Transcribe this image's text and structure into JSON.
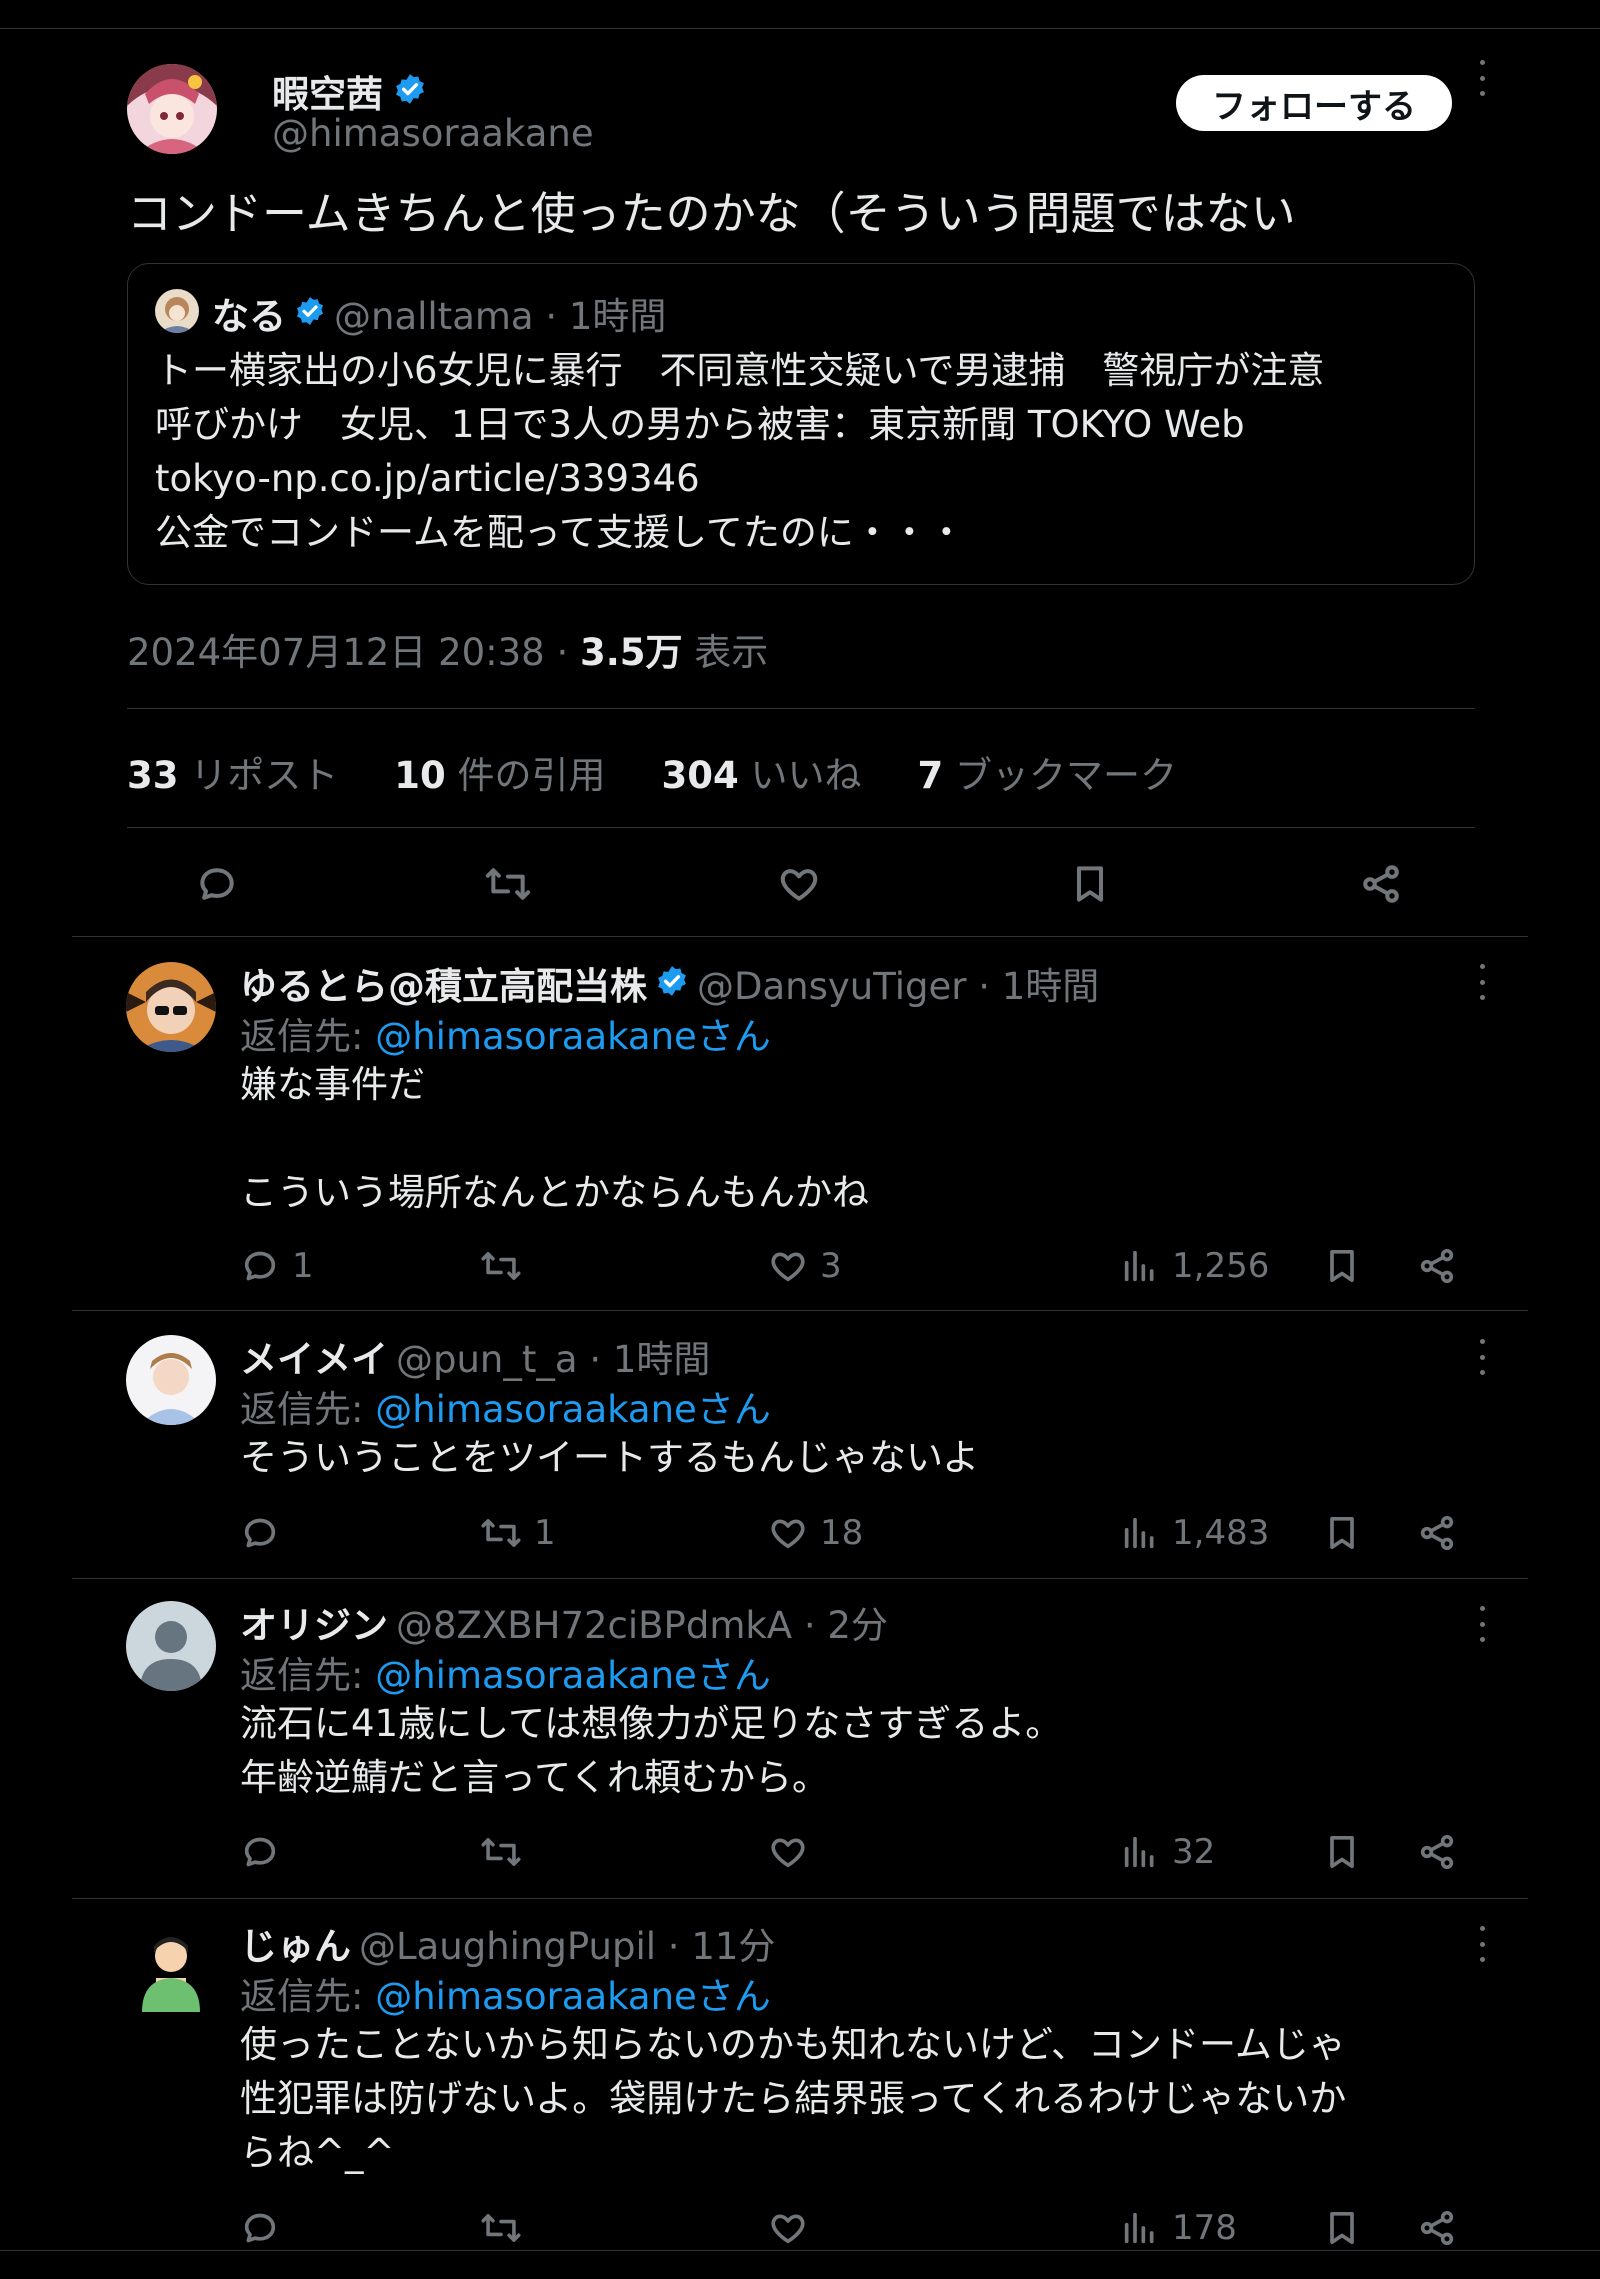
{
  "main_tweet": {
    "author_name": "暇空茜",
    "author_handle": "@himasoraakane",
    "follow_label": "フォローする",
    "text": "コンドームきちんと使ったのかな（そういう問題ではない",
    "quote": {
      "name": "なる",
      "meta": "@nalltama · 1時間",
      "lines": [
        "トー横家出の小6女児に暴行　不同意性交疑いで男逮捕　警視庁が注意",
        "呼びかけ　女児、1日で3人の男から被害：東京新聞 TOKYO Web",
        "tokyo-np.co.jp/article/339346",
        "公金でコンドームを配って支援してたのに・・・"
      ]
    },
    "timestamp": "2024年07月12日 20:38 · ",
    "views_count": "3.5万",
    "views_label": " 表示",
    "stats": [
      {
        "count": "33",
        "label": " リポスト"
      },
      {
        "count": "10",
        "label": " 件の引用"
      },
      {
        "count": "304",
        "label": " いいね"
      },
      {
        "count": "7",
        "label": " ブックマーク"
      }
    ]
  },
  "reply_to_prefix": "返信先: ",
  "reply_to_target": "@himasoraakaneさん",
  "replies": [
    {
      "name": "ゆるとら@積立高配当株",
      "verified": true,
      "meta": "@DansyuTiger · 1時間",
      "text": "嫌な事件だ\n\nこういう場所なんとかならんもんかね",
      "reply_count": "1",
      "repost_count": "",
      "like_count": "3",
      "view_count": "1,256"
    },
    {
      "name": "メイメイ",
      "verified": false,
      "meta": "@pun_t_a · 1時間",
      "text": "そういうことをツイートするもんじゃないよ",
      "reply_count": "",
      "repost_count": "1",
      "like_count": "18",
      "view_count": "1,483"
    },
    {
      "name": "オリジン",
      "verified": false,
      "meta": "@8ZXBH72ciBPdmkA · 2分",
      "text": "流石に41歳にしては想像力が足りなさすぎるよ。\n年齢逆鯖だと言ってくれ頼むから。",
      "reply_count": "",
      "repost_count": "",
      "like_count": "",
      "view_count": "32"
    },
    {
      "name": "じゅん",
      "verified": false,
      "meta": "@LaughingPupil · 11分",
      "text": "使ったことないから知らないのかも知れないけど、コンドームじゃ\n性犯罪は防げないよ。袋開けたら結界張ってくれるわけじゃないか\nらね^_^",
      "reply_count": "",
      "repost_count": "",
      "like_count": "",
      "view_count": "178"
    }
  ],
  "colors": {
    "background": "#000000",
    "text": "#e7e9ea",
    "muted": "#71767b",
    "accent": "#1d9bf0",
    "divider": "#2f3336"
  }
}
